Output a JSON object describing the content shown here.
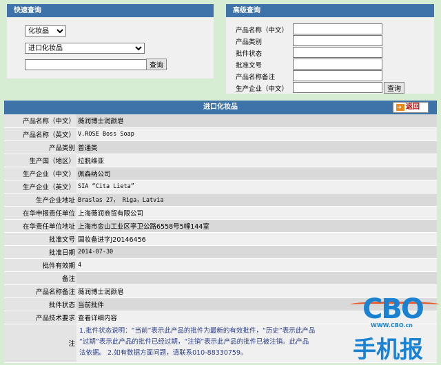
{
  "quick": {
    "title": "快速查询",
    "category_select": "化妆品",
    "type_select": "进口化妆品",
    "input_value": "",
    "button": "查询"
  },
  "advanced": {
    "title": "高级查询",
    "fields": [
      {
        "label": "产品名称（中文）"
      },
      {
        "label": "产品类别"
      },
      {
        "label": "批件状态"
      },
      {
        "label": "批准文号"
      },
      {
        "label": "产品名称备注"
      },
      {
        "label": "生产企业（中文）"
      }
    ],
    "button": "查询"
  },
  "detail": {
    "title": "进口化妆品",
    "back_button": "返回",
    "rows": [
      {
        "key": "产品名称（中文）",
        "value": "薇润博士润颜皂"
      },
      {
        "key": "产品名称（英文）",
        "value": "V.ROSE Boss Soap"
      },
      {
        "key": "产品类别",
        "value": "普通类"
      },
      {
        "key": "生产国（地区）",
        "value": "拉脱维亚"
      },
      {
        "key": "生产企业（中文）",
        "value": "佩森纳公司"
      },
      {
        "key": "生产企业（英文）",
        "value": "SIA “Cita Lieta”"
      },
      {
        "key": "生产企业地址",
        "value": "Braslas 27， Riga，Latvia"
      },
      {
        "key": "在华申报责任单位",
        "value": "上海薇润商贸有限公司"
      },
      {
        "key": "在华责任单位地址",
        "value": "上海市金山工业区亭卫公路6558号5幢144室"
      },
      {
        "key": "批准文号",
        "value": "国妆备进字J20146456"
      },
      {
        "key": "批准日期",
        "value": "2014-07-30"
      },
      {
        "key": "批件有效期",
        "value": "4"
      },
      {
        "key": "备注",
        "value": ""
      },
      {
        "key": "产品名称备注",
        "value": "薇润博士润颜皂"
      },
      {
        "key": "批件状态",
        "value": "当前批件"
      },
      {
        "key": "产品技术要求",
        "value": "查看详细内容"
      }
    ],
    "note": {
      "key": "注",
      "line1": "1.批件状态说明：“当前”表示此产品的批件为最新的有效批件，“历史”表示此产品",
      "line2": "“过期”表示此产品的批件已经过期，“注销”表示此产品的批件已被注销。此产品",
      "line3": "法依据。 2.如有数据方面问题，请联系010-88330759。"
    }
  },
  "watermark": {
    "logo": "CBO",
    "url": "WWW.CBO.cn",
    "brand": "手机报"
  },
  "colors": {
    "header_bg": "#3d73a8",
    "page_bg": "#d6ecd3",
    "note_text": "#2c3e88",
    "back_text": "#b30000",
    "logo_blue": "#1a82d0"
  }
}
